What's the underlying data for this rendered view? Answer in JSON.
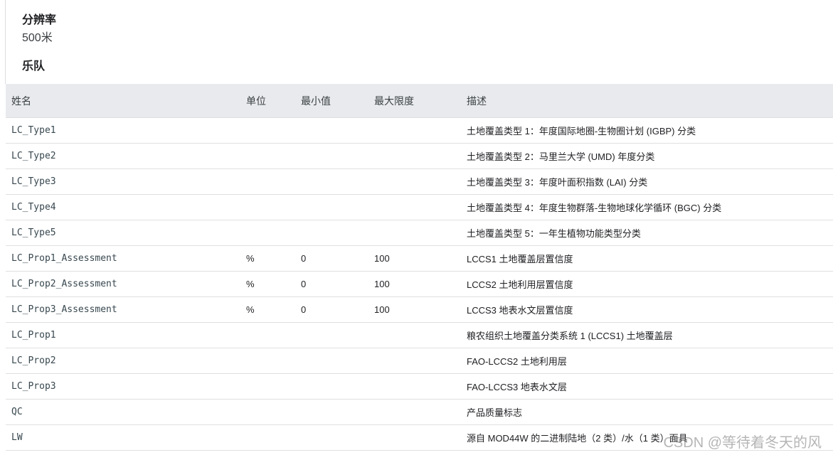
{
  "resolution": {
    "heading": "分辨率",
    "value": "500米"
  },
  "bands_heading": "乐队",
  "table": {
    "headers": {
      "name": "姓名",
      "unit": "单位",
      "min": "最小值",
      "max": "最大限度",
      "description": "描述"
    },
    "rows": [
      {
        "name": "LC_Type1",
        "unit": "",
        "min": "",
        "max": "",
        "description": "土地覆盖类型 1：年度国际地圈-生物圈计划 (IGBP) 分类"
      },
      {
        "name": "LC_Type2",
        "unit": "",
        "min": "",
        "max": "",
        "description": "土地覆盖类型 2：马里兰大学 (UMD) 年度分类"
      },
      {
        "name": "LC_Type3",
        "unit": "",
        "min": "",
        "max": "",
        "description": "土地覆盖类型 3：年度叶面积指数 (LAI) 分类"
      },
      {
        "name": "LC_Type4",
        "unit": "",
        "min": "",
        "max": "",
        "description": "土地覆盖类型 4：年度生物群落-生物地球化学循环 (BGC) 分类"
      },
      {
        "name": "LC_Type5",
        "unit": "",
        "min": "",
        "max": "",
        "description": "土地覆盖类型 5：一年生植物功能类型分类"
      },
      {
        "name": "LC_Prop1_Assessment",
        "unit": "%",
        "min": "0",
        "max": "100",
        "description": "LCCS1 土地覆盖层置信度"
      },
      {
        "name": "LC_Prop2_Assessment",
        "unit": "%",
        "min": "0",
        "max": "100",
        "description": "LCCS2 土地利用层置信度"
      },
      {
        "name": "LC_Prop3_Assessment",
        "unit": "%",
        "min": "0",
        "max": "100",
        "description": "LCCS3 地表水文层置信度"
      },
      {
        "name": "LC_Prop1",
        "unit": "",
        "min": "",
        "max": "",
        "description": "粮农组织土地覆盖分类系统 1 (LCCS1) 土地覆盖层"
      },
      {
        "name": "LC_Prop2",
        "unit": "",
        "min": "",
        "max": "",
        "description": "FAO-LCCS2 土地利用层"
      },
      {
        "name": "LC_Prop3",
        "unit": "",
        "min": "",
        "max": "",
        "description": "FAO-LCCS3 地表水文层"
      },
      {
        "name": "QC",
        "unit": "",
        "min": "",
        "max": "",
        "description": "产品质量标志"
      },
      {
        "name": "LW",
        "unit": "",
        "min": "",
        "max": "",
        "description": "源自 MOD44W 的二进制陆地（2 类）/水（1 类）面具"
      }
    ]
  },
  "watermark": "CSDN @等待着冬天的风"
}
